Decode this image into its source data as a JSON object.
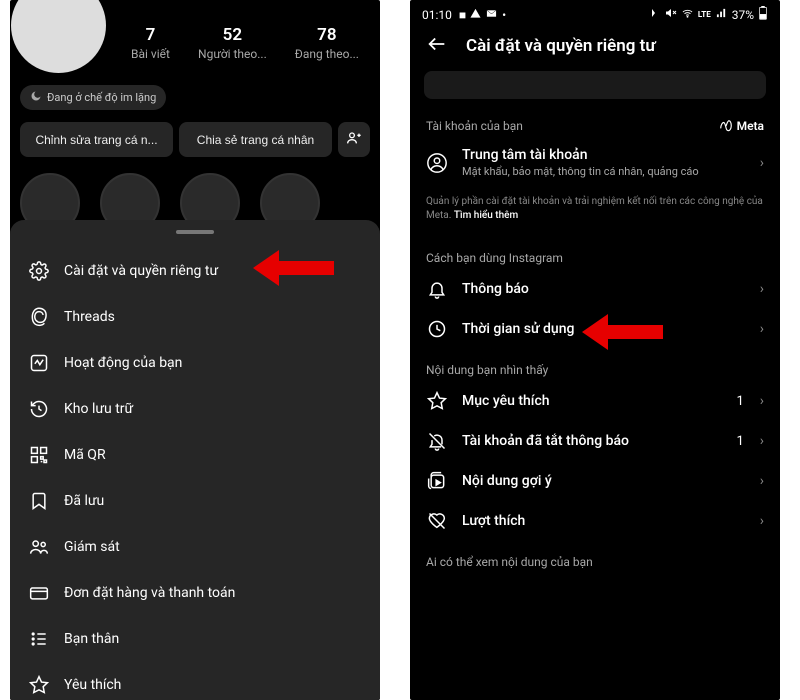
{
  "left": {
    "stats": [
      {
        "count": "7",
        "label": "Bài viết"
      },
      {
        "count": "52",
        "label": "Người theo..."
      },
      {
        "count": "78",
        "label": "Đang theo..."
      }
    ],
    "silent_mode": "Đang ở chế độ im lặng",
    "edit_profile": "Chỉnh sửa trang cá n...",
    "share_profile": "Chia sẻ trang cá nhân",
    "menu": [
      {
        "name": "settings-privacy",
        "label": "Cài đặt và quyền riêng tư",
        "icon": "gear"
      },
      {
        "name": "threads",
        "label": "Threads",
        "icon": "threads"
      },
      {
        "name": "your-activity",
        "label": "Hoạt động của bạn",
        "icon": "activity"
      },
      {
        "name": "archive",
        "label": "Kho lưu trữ",
        "icon": "archive"
      },
      {
        "name": "qr-code",
        "label": "Mã QR",
        "icon": "qr"
      },
      {
        "name": "saved",
        "label": "Đã lưu",
        "icon": "bookmark"
      },
      {
        "name": "supervision",
        "label": "Giám sát",
        "icon": "supervision"
      },
      {
        "name": "orders-payments",
        "label": "Đơn đặt hàng và thanh toán",
        "icon": "card"
      },
      {
        "name": "close-friends",
        "label": "Bạn thân",
        "icon": "list"
      },
      {
        "name": "favorites",
        "label": "Yêu thích",
        "icon": "star"
      }
    ]
  },
  "right": {
    "status_bar": {
      "time": "01:10",
      "battery_pct": "37%"
    },
    "title": "Cài đặt và quyền riêng tư",
    "your_account_section": "Tài khoản của bạn",
    "meta_brand": "Meta",
    "account_center": {
      "title": "Trung tâm tài khoản",
      "subtitle": "Mật khẩu, bảo mật, thông tin cá nhân, quảng cáo"
    },
    "info_text": "Quản lý phần cài đặt tài khoản và trải nghiệm kết nối trên các công nghệ của Meta.",
    "info_link": "Tìm hiểu thêm",
    "how_you_use": "Cách bạn dùng Instagram",
    "items_usage": [
      {
        "name": "notifications",
        "label": "Thông báo",
        "icon": "bell"
      },
      {
        "name": "time-spent",
        "label": "Thời gian sử dụng",
        "icon": "clock"
      }
    ],
    "what_you_see": "Nội dung bạn nhìn thấy",
    "items_see": [
      {
        "name": "favorites",
        "label": "Mục yêu thích",
        "icon": "star",
        "count": "1"
      },
      {
        "name": "muted-accounts",
        "label": "Tài khoản đã tắt thông báo",
        "icon": "mute",
        "count": "1"
      },
      {
        "name": "suggested-content",
        "label": "Nội dung gợi ý",
        "icon": "reels"
      },
      {
        "name": "likes",
        "label": "Lượt thích",
        "icon": "heart-off"
      }
    ],
    "who_can_see": "Ai có thể xem nội dung của bạn"
  }
}
